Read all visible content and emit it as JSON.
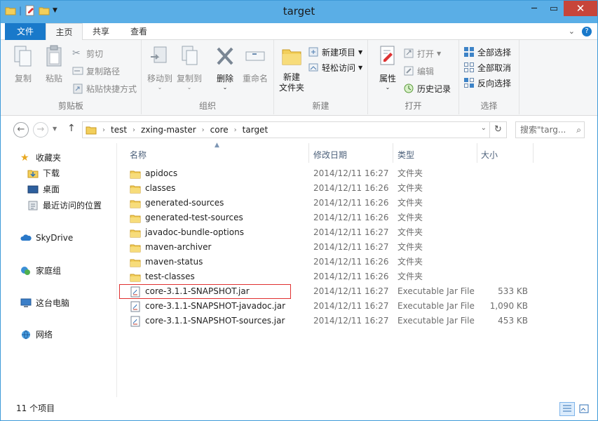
{
  "window": {
    "title": "target"
  },
  "tabs": {
    "file": "文件",
    "home": "主页",
    "share": "共享",
    "view": "查看"
  },
  "ribbon": {
    "clipboard": {
      "label": "剪贴板",
      "copy": "复制",
      "paste": "粘贴",
      "cut": "剪切",
      "copy_path": "复制路径",
      "paste_shortcut": "粘贴快捷方式"
    },
    "organize": {
      "label": "组织",
      "move_to": "移动到",
      "copy_to": "复制到",
      "delete": "删除",
      "rename": "重命名"
    },
    "new": {
      "label": "新建",
      "new_folder": "新建\n文件夹",
      "new_item": "新建项目",
      "easy_access": "轻松访问"
    },
    "open": {
      "label": "打开",
      "properties": "属性",
      "open": "打开",
      "edit": "编辑",
      "history": "历史记录"
    },
    "select": {
      "label": "选择",
      "select_all": "全部选择",
      "select_none": "全部取消",
      "invert": "反向选择"
    }
  },
  "address": {
    "crumbs": [
      "test",
      "zxing-master",
      "core",
      "target"
    ],
    "search_placeholder": "搜索\"targ..."
  },
  "nav": {
    "favorites": "收藏夹",
    "downloads": "下载",
    "desktop": "桌面",
    "recent": "最近访问的位置",
    "skydrive": "SkyDrive",
    "homegroup": "家庭组",
    "this_pc": "这台电脑",
    "network": "网络"
  },
  "columns": {
    "name": "名称",
    "date": "修改日期",
    "type": "类型",
    "size": "大小"
  },
  "files": [
    {
      "name": "apidocs",
      "date": "2014/12/11 16:27",
      "type": "文件夹",
      "size": "",
      "kind": "folder"
    },
    {
      "name": "classes",
      "date": "2014/12/11 16:26",
      "type": "文件夹",
      "size": "",
      "kind": "folder"
    },
    {
      "name": "generated-sources",
      "date": "2014/12/11 16:26",
      "type": "文件夹",
      "size": "",
      "kind": "folder"
    },
    {
      "name": "generated-test-sources",
      "date": "2014/12/11 16:26",
      "type": "文件夹",
      "size": "",
      "kind": "folder"
    },
    {
      "name": "javadoc-bundle-options",
      "date": "2014/12/11 16:27",
      "type": "文件夹",
      "size": "",
      "kind": "folder"
    },
    {
      "name": "maven-archiver",
      "date": "2014/12/11 16:27",
      "type": "文件夹",
      "size": "",
      "kind": "folder"
    },
    {
      "name": "maven-status",
      "date": "2014/12/11 16:26",
      "type": "文件夹",
      "size": "",
      "kind": "folder"
    },
    {
      "name": "test-classes",
      "date": "2014/12/11 16:26",
      "type": "文件夹",
      "size": "",
      "kind": "folder"
    },
    {
      "name": "core-3.1.1-SNAPSHOT.jar",
      "date": "2014/12/11 16:27",
      "type": "Executable Jar File",
      "size": "533 KB",
      "kind": "jar"
    },
    {
      "name": "core-3.1.1-SNAPSHOT-javadoc.jar",
      "date": "2014/12/11 16:27",
      "type": "Executable Jar File",
      "size": "1,090 KB",
      "kind": "jar"
    },
    {
      "name": "core-3.1.1-SNAPSHOT-sources.jar",
      "date": "2014/12/11 16:27",
      "type": "Executable Jar File",
      "size": "453 KB",
      "kind": "jar"
    }
  ],
  "status": {
    "count": "11 个项目"
  },
  "colors": {
    "accent": "#1979ca",
    "titlebar": "#5aaee6",
    "folder": "#e8c040",
    "highlight_box": "#e03030"
  }
}
